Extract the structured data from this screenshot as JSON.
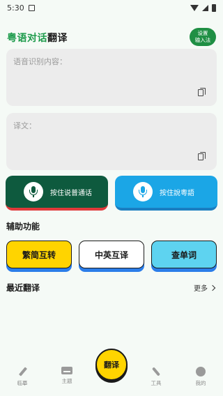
{
  "status_bar": {
    "time": "5:30"
  },
  "header": {
    "title_part1": "粤语对话",
    "title_part2": "翻译",
    "ime_line1": "设置",
    "ime_line2": "输入法"
  },
  "recognition_box": {
    "placeholder": "语音识别内容：",
    "icon": "copy-icon"
  },
  "translation_box": {
    "placeholder": "译文：",
    "icon": "copy-icon"
  },
  "voice_buttons": [
    {
      "label": "按住说普通话",
      "icon": "microphone-icon",
      "color": "#0e5a3e",
      "accent": "#e03a3a"
    },
    {
      "label": "按住說粵語",
      "icon": "microphone-icon",
      "color": "#1ba6e6",
      "accent": "#1a7ec1"
    }
  ],
  "tools_section": {
    "title": "辅助功能",
    "items": [
      {
        "label": "繁简互转",
        "color": "#ffd400"
      },
      {
        "label": "中英互译",
        "color": "#ffffff"
      },
      {
        "label": "查单词",
        "color": "#5ed3f0"
      }
    ]
  },
  "recent_section": {
    "title": "最近翻译",
    "more_label": "更多"
  },
  "bottom_nav": {
    "items": [
      {
        "label": "临摹",
        "icon": "pen-icon"
      },
      {
        "label": "主题",
        "icon": "keyboard-icon"
      },
      {
        "label": "工具",
        "icon": "wrench-icon"
      },
      {
        "label": "我的",
        "icon": "profile-icon"
      }
    ],
    "center_label": "翻译"
  }
}
